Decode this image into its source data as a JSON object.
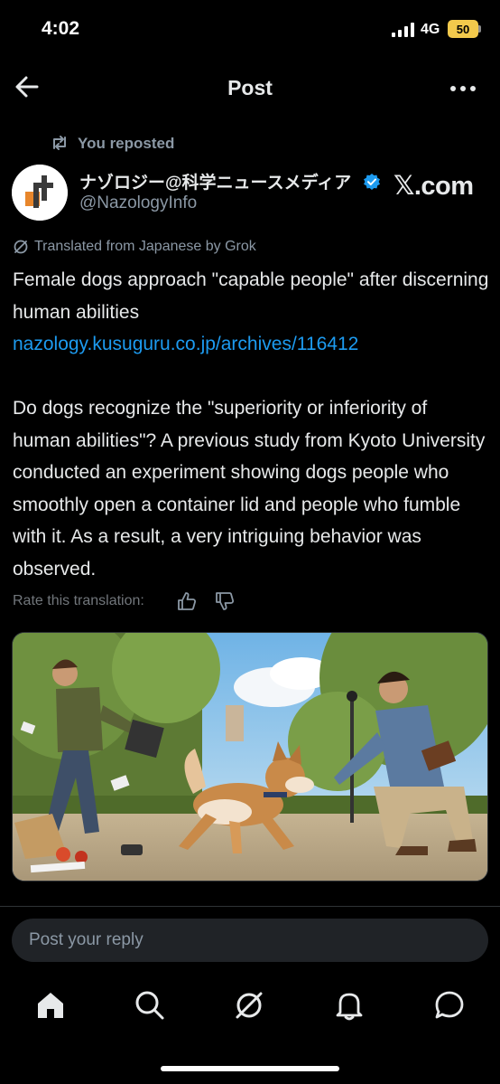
{
  "status_bar": {
    "time": "4:02",
    "network": "4G",
    "battery": "50"
  },
  "header": {
    "title": "Post"
  },
  "repost": {
    "label": "You reposted"
  },
  "author": {
    "display_name": "ナゾロジー@科学ニュースメディア",
    "handle": "@NazologyInfo",
    "brand_text": "𝕏.com"
  },
  "translation": {
    "label": "Translated from Japanese by Grok",
    "rate_label": "Rate this translation:"
  },
  "post": {
    "line1": "Female dogs approach \"capable people\" after discerning human abilities",
    "link": "nazology.kusuguru.co.jp/archives/116412",
    "body": "Do dogs recognize the \"superiority or inferiority of human abilities\"? A previous study from Kyoto University conducted an experiment showing dogs people who smoothly open a container lid and people who fumble with it. As a result, a very intriguing behavior was observed."
  },
  "reply": {
    "placeholder": "Post your reply"
  },
  "icons": {
    "back": "arrow-left-icon",
    "more": "more-icon",
    "repost": "repost-icon",
    "verified": "verified-badge-icon",
    "grok": "grok-icon",
    "nav": [
      "home-icon",
      "search-icon",
      "grok-icon",
      "bell-icon",
      "message-icon"
    ]
  },
  "colors": {
    "link": "#1d9bf0",
    "verified": "#1d9bf0",
    "secondary_text": "#8b98a5",
    "battery": "#f2c94c"
  }
}
